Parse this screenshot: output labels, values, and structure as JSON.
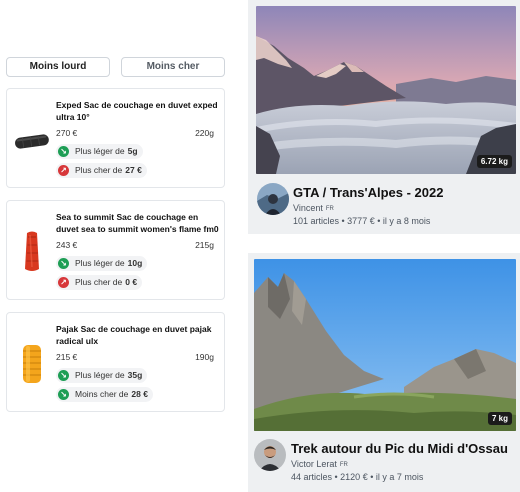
{
  "tabs": {
    "lightest": "Moins lourd",
    "cheapest": "Moins cher",
    "active": "lightest"
  },
  "products": [
    {
      "title": "Exped Sac de couchage en duvet exped ultra 10°",
      "price": "270 €",
      "weight": "220g",
      "badges": [
        {
          "text": "Plus léger de",
          "value": "5g",
          "direction": "down",
          "color": "#1e9e55"
        },
        {
          "text": "Plus cher de",
          "value": "27 €",
          "direction": "up",
          "color": "#d7373a"
        }
      ],
      "image": "black-sleeping-bag"
    },
    {
      "title": "Sea to summit Sac de couchage en duvet sea to summit women's flame fm0",
      "price": "243 €",
      "weight": "215g",
      "badges": [
        {
          "text": "Plus léger de",
          "value": "10g",
          "direction": "down",
          "color": "#1e9e55"
        },
        {
          "text": "Plus cher de",
          "value": "0 €",
          "direction": "up",
          "color": "#d7373a"
        }
      ],
      "image": "red-sleeping-bag"
    },
    {
      "title": "Pajak Sac de couchage en duvet pajak radical ulx",
      "price": "215 €",
      "weight": "190g",
      "badges": [
        {
          "text": "Plus léger de",
          "value": "35g",
          "direction": "down",
          "color": "#1e9e55"
        },
        {
          "text": "Moins cher de",
          "value": "28 €",
          "direction": "down",
          "color": "#1e9e55"
        }
      ],
      "image": "yellow-sleeping-bag"
    }
  ],
  "trips": [
    {
      "title": "GTA / Trans'Alpes - 2022",
      "author": "Vincent",
      "country": "FR",
      "meta": "101 articles • 3777 € • il y a 8 mois",
      "weight": "6.72 kg",
      "image": "alpine-sunset-sea-of-clouds"
    },
    {
      "title": "Trek autour du Pic du Midi d'Ossau",
      "author": "Victor Lerat",
      "country": "FR",
      "meta": "44 articles • 2120 € • il y a 7 mois",
      "weight": "7 kg",
      "image": "pyrenees-peaks-blue-sky"
    }
  ],
  "colors": {
    "positive": "#1e9e55",
    "negative": "#d7373a",
    "card_bg": "#eef0f2"
  }
}
